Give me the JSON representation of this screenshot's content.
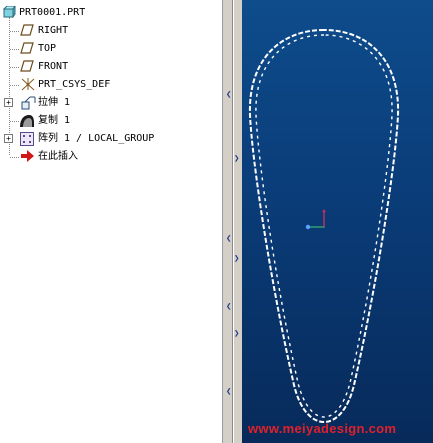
{
  "model_tree": {
    "items": [
      {
        "label": "PRT0001.PRT",
        "icon": "part-icon"
      },
      {
        "label": "RIGHT",
        "icon": "datum-plane-icon"
      },
      {
        "label": "TOP",
        "icon": "datum-plane-icon"
      },
      {
        "label": "FRONT",
        "icon": "datum-plane-icon"
      },
      {
        "label": "PRT_CSYS_DEF",
        "icon": "coordinate-system-icon"
      },
      {
        "label": "拉伸 1",
        "icon": "extrude-icon"
      },
      {
        "label": "复制 1",
        "icon": "copy-feature-icon"
      },
      {
        "label": "阵列 1 / LOCAL_GROUP",
        "icon": "pattern-icon"
      },
      {
        "label": "在此插入",
        "icon": "insert-here-arrow-icon"
      }
    ],
    "expand_symbol": "+"
  },
  "splitter": {
    "arrows": [
      "left",
      "right",
      "left",
      "right",
      "left",
      "right",
      "left"
    ]
  },
  "viewport": {
    "background_top": "#0e4c8c",
    "background_bottom": "#072a5a",
    "geometry_color": "#ffffff",
    "csys_colors": {
      "x": "#2f9e6e",
      "y": "#c0305a",
      "origin": "#5aa0ff"
    }
  },
  "watermark": {
    "text": "www.meiyadesign.com",
    "color": "#e2202a"
  }
}
